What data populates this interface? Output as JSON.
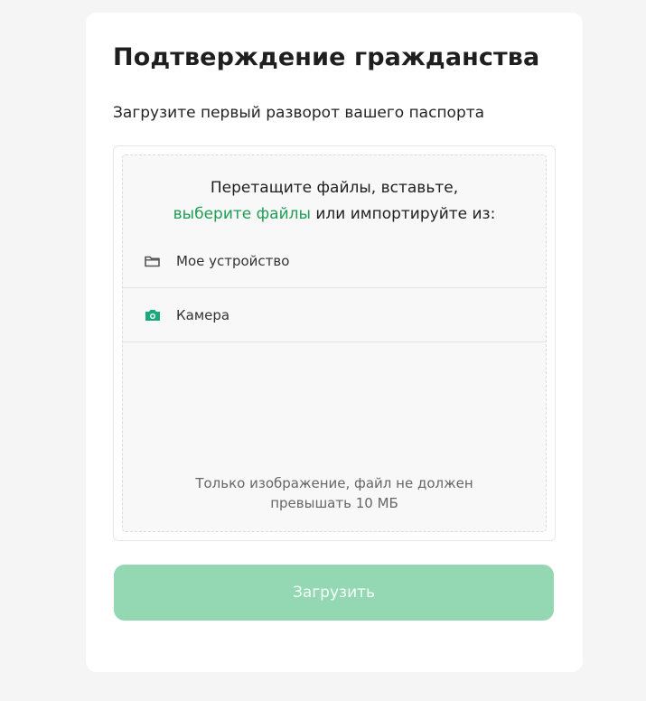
{
  "page": {
    "title": "Подтверждение гражданства",
    "subtitle": "Загрузите первый разворот вашего паспорта"
  },
  "uploader": {
    "drop_text_line1": "Перетащите файлы, вставьте,",
    "browse_link": "выберите файлы",
    "drop_text_line2_rest": " или импортируйте из:",
    "sources": [
      {
        "label": "Мое устройство",
        "icon": "folder-icon"
      },
      {
        "label": "Камера",
        "icon": "camera-icon"
      }
    ],
    "restriction_line1": "Только изображение, файл не должен",
    "restriction_line2": "превышать 10 МБ"
  },
  "actions": {
    "submit_label": "Загрузить"
  },
  "colors": {
    "background": "#f5f5f5",
    "card": "#ffffff",
    "accent_green": "#1f9d55",
    "camera_icon": "#19a97b",
    "submit_disabled": "#93d8b2"
  }
}
